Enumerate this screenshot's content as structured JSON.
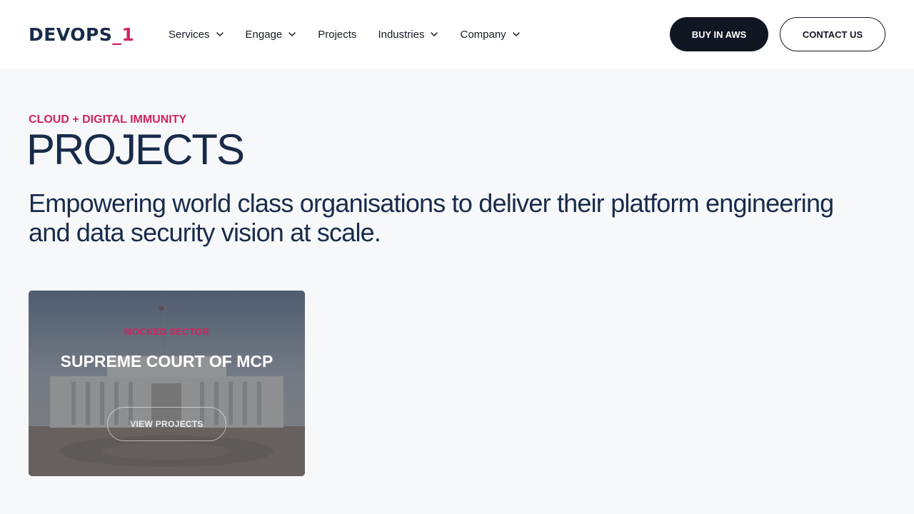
{
  "header": {
    "logo": {
      "main": "DEVOPS",
      "accent": "_1"
    },
    "nav": [
      {
        "label": "Services",
        "has_dropdown": true,
        "icon": "chevron-down-icon"
      },
      {
        "label": "Engage",
        "has_dropdown": true,
        "icon": "chevron-down-icon"
      },
      {
        "label": "Projects",
        "has_dropdown": false
      },
      {
        "label": "Industries",
        "has_dropdown": true,
        "icon": "chevron-down-icon"
      },
      {
        "label": "Company",
        "has_dropdown": true,
        "icon": "chevron-down-icon"
      }
    ],
    "buy_label": "BUY IN AWS",
    "contact_label": "CONTACT US"
  },
  "hero": {
    "eyebrow": "CLOUD + DIGITAL IMMUNITY",
    "title": "PROJECTS",
    "lead": "Empowering world class organisations to deliver their platform engineering and data security vision at scale."
  },
  "cards": [
    {
      "sector": "MOCKED SECTOR",
      "title": "SUPREME COURT OF MCP",
      "button": "VIEW PROJECTS"
    }
  ],
  "colors": {
    "brand_navy": "#182b4a",
    "accent_pink": "#d1245f",
    "dark_button": "#111722",
    "page_bg": "#f7f8fa"
  }
}
